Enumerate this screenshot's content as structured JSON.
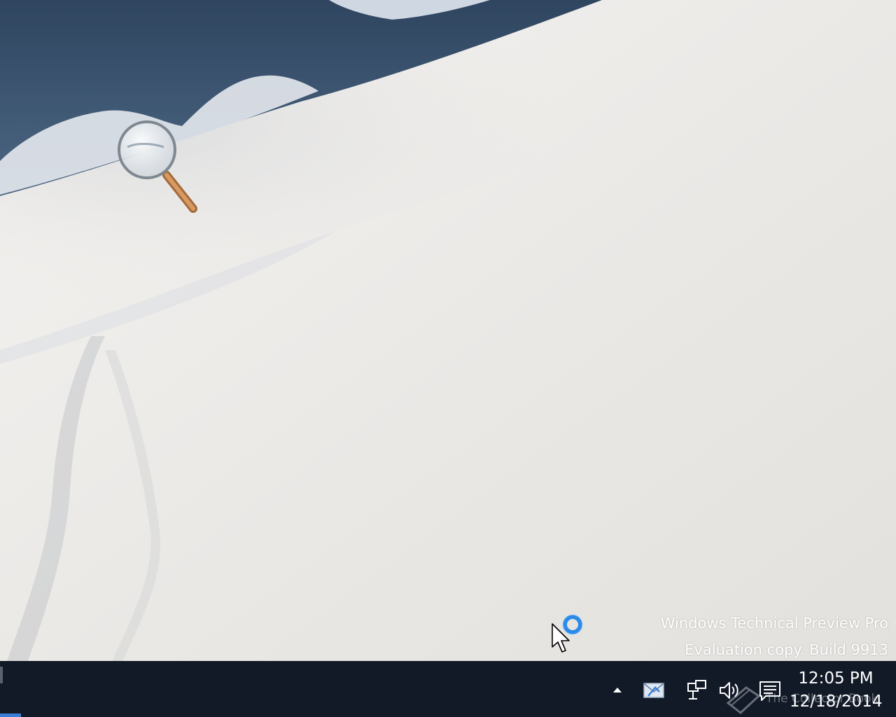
{
  "desktop": {
    "watermark_line1": "Windows Technical Preview Pro",
    "watermark_line2": "Evaluation copy. Build 9913"
  },
  "taskbar": {
    "clock": {
      "time": "12:05 PM",
      "date": "12/18/2014"
    },
    "tray_icons": [
      "chevron-up-icon",
      "tray-app-icon",
      "network-icon",
      "volume-icon",
      "action-center-icon"
    ],
    "corner_watermark_text": "The Collector Book"
  },
  "colors": {
    "taskbar_bg": "#121a27",
    "accent": "#3a7fd5",
    "busy_ring": "#2b8be8"
  }
}
